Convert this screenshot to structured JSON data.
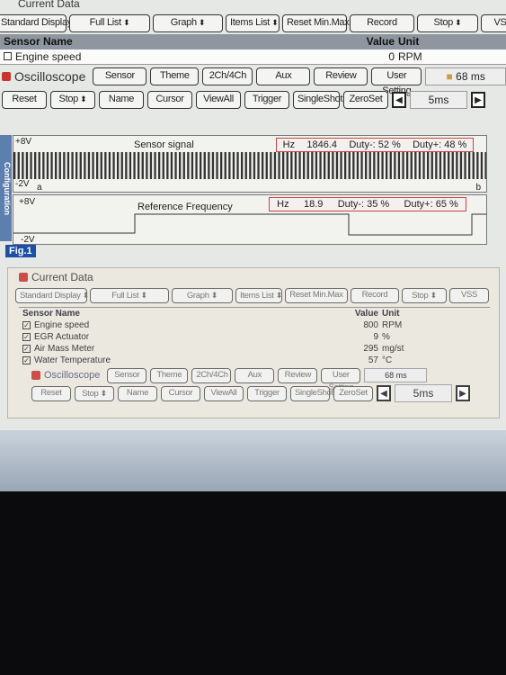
{
  "title": "Current Data",
  "toolbar1": [
    "Standard Display",
    "Full List",
    "Graph",
    "Items List",
    "Reset Min.Max.",
    "Record",
    "Stop",
    "VSS"
  ],
  "table": {
    "headers": {
      "name": "Sensor Name",
      "value": "Value",
      "unit": "Unit"
    },
    "rows": [
      {
        "name": "Engine speed",
        "value": "0",
        "unit": "RPM"
      }
    ]
  },
  "osc": {
    "label": "Oscilloscope",
    "buttons": [
      "Sensor",
      "Theme",
      "2Ch/4Ch",
      "Aux",
      "Review",
      "User Setting"
    ],
    "timer": "68 ms",
    "buttons2": [
      "Reset",
      "Stop",
      "Name",
      "Cursor",
      "ViewAll",
      "Trigger",
      "SingleShot",
      "ZeroSet"
    ],
    "timebase": "5ms"
  },
  "config_label": "Configuration",
  "fig_label": "Fig.1",
  "ch1": {
    "name": "Sensor signal",
    "top": "+8V",
    "bottom": "-2V",
    "cursor_a": "a",
    "cursor_b": "b",
    "hz_label": "Hz",
    "hz": "1846.4",
    "duty_minus": "Duty-: 52 %",
    "duty_plus": "Duty+: 48 %"
  },
  "ch2": {
    "name": "Reference Frequency",
    "top": "+8V",
    "bottom": "-2V",
    "hz_label": "Hz",
    "hz": "18.9",
    "duty_minus": "Duty-: 35 %",
    "duty_plus": "Duty+: 65 %"
  },
  "inner": {
    "title": "Current Data",
    "toolbar": [
      "Standard Display",
      "Full List",
      "Graph",
      "Items List",
      "Reset Min.Max",
      "Record",
      "Stop",
      "VSS"
    ],
    "headers": {
      "name": "Sensor Name",
      "value": "Value",
      "unit": "Unit"
    },
    "rows": [
      {
        "name": "Engine speed",
        "value": "800",
        "unit": "RPM"
      },
      {
        "name": "EGR Actuator",
        "value": "9",
        "unit": "%"
      },
      {
        "name": "Air Mass Meter",
        "value": "295",
        "unit": "mg/st"
      },
      {
        "name": "Water Temperature",
        "value": "57",
        "unit": "°C"
      }
    ],
    "osc_label": "Oscilloscope",
    "osc_buttons": [
      "Sensor",
      "Theme",
      "2Ch/4Ch",
      "Aux",
      "Review",
      "User Setting"
    ],
    "timer": "68 ms",
    "osc_buttons2": [
      "Reset",
      "Stop",
      "Name",
      "Cursor",
      "ViewAll",
      "Trigger",
      "SingleShot",
      "ZeroSet"
    ],
    "timebase": "5ms"
  }
}
